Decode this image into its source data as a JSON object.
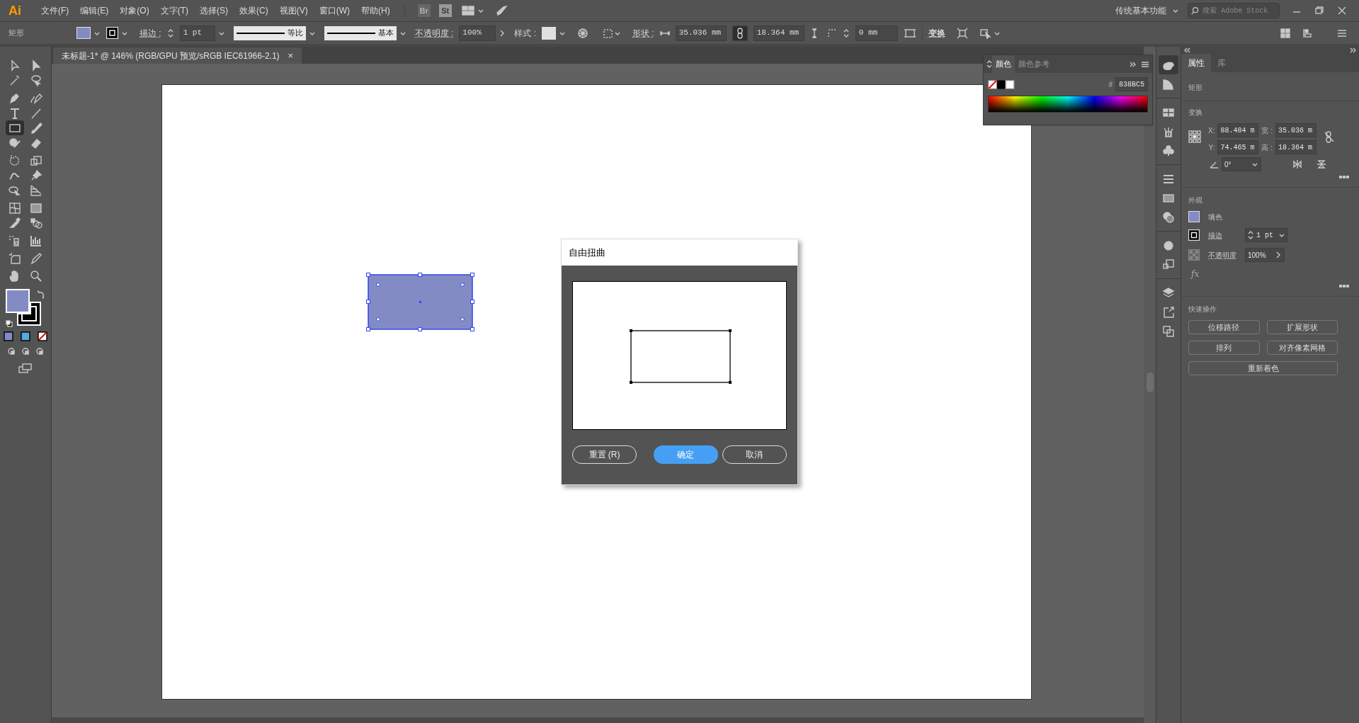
{
  "app_logo": "Ai",
  "menu": [
    "文件(F)",
    "编辑(E)",
    "对象(O)",
    "文字(T)",
    "选择(S)",
    "效果(C)",
    "视图(V)",
    "窗口(W)",
    "帮助(H)"
  ],
  "bridge_labels": [
    "Br",
    "St"
  ],
  "workspace": "传统基本功能",
  "search": {
    "placeholder": "搜索 Adobe Stock"
  },
  "control_bar": {
    "object_type": "矩形",
    "stroke_label": "描边 :",
    "stroke_weight": "1 pt",
    "stroke_profile": "等比",
    "brush": "基本",
    "opacity_label": "不透明度 :",
    "opacity": "100%",
    "style_label": "样式 :",
    "shape_label": "形状 :",
    "width": "35.036 mm",
    "height": "18.364 mm",
    "corner": "0 mm",
    "transform": "变换"
  },
  "document_tab": {
    "title": "未标题-1* @ 146% (RGB/GPU 预览/sRGB IEC61966-2.1)",
    "close": "×"
  },
  "tools": [
    {
      "selected": false
    },
    {
      "selected": false
    },
    {
      "selected": false
    },
    {
      "selected": false
    },
    {
      "selected": false
    },
    {
      "selected": false
    },
    {
      "selected": false
    },
    {
      "selected": false
    },
    {
      "selected": true
    },
    {
      "selected": false
    },
    {
      "selected": false
    },
    {
      "selected": false
    },
    {
      "selected": false
    },
    {
      "selected": false
    },
    {
      "selected": false
    },
    {
      "selected": false
    },
    {
      "selected": false
    },
    {
      "selected": false
    },
    {
      "selected": false
    },
    {
      "selected": false
    },
    {
      "selected": false
    },
    {
      "selected": false
    },
    {
      "selected": false
    },
    {
      "selected": false
    },
    {
      "selected": false
    },
    {
      "selected": false
    },
    {
      "selected": false
    },
    {
      "selected": false
    }
  ],
  "color_panel": {
    "tabs": [
      {
        "label": "颜色",
        "selected": true
      },
      {
        "label": "颜色参考",
        "selected": false
      }
    ],
    "hash": "#",
    "hex": "838BC5"
  },
  "properties_panel": {
    "tabs": [
      {
        "label": "属性",
        "selected": true
      },
      {
        "label": "库",
        "selected": false
      }
    ],
    "object_type": "矩形",
    "transform": {
      "title": "变换",
      "fields": [
        {
          "label": "X:",
          "value": "88.484 m"
        },
        {
          "label": "宽 :",
          "value": "35.036 m"
        },
        {
          "label": "Y:",
          "value": "74.465 m"
        },
        {
          "label": "高 :",
          "value": "18.364 m"
        }
      ],
      "angle": "0°"
    },
    "appearance": {
      "title": "外观",
      "fill": "填色",
      "stroke": "描边",
      "stroke_weight": "1 pt",
      "opacity_label": "不透明度",
      "opacity": "100%",
      "fx": "fx"
    },
    "quick_actions": {
      "title": "快速操作",
      "buttons": [
        "位移路径",
        "扩展形状",
        "排列",
        "对齐像素网格",
        "重新着色"
      ]
    }
  },
  "dialog": {
    "title": "自由扭曲",
    "buttons": [
      {
        "label": "重置 (R)",
        "primary": false
      },
      {
        "label": "确定",
        "primary": true
      },
      {
        "label": "取消",
        "primary": false
      }
    ]
  }
}
